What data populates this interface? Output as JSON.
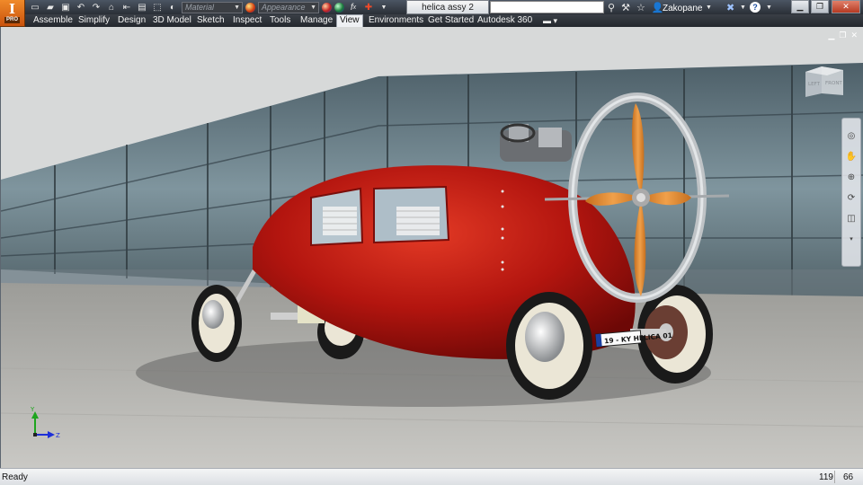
{
  "app": {
    "logo": "I",
    "edition": "PRO"
  },
  "quick_access": {
    "material_placeholder": "Material",
    "appearance_placeholder": "Appearance"
  },
  "document": {
    "title": "helica assy 2"
  },
  "user": {
    "name": "Zakopane"
  },
  "ribbon": {
    "tabs": [
      {
        "label": "Assemble",
        "active": false
      },
      {
        "label": "Simplify",
        "active": false
      },
      {
        "label": "Design",
        "active": false
      },
      {
        "label": "3D Model",
        "active": false
      },
      {
        "label": "Sketch",
        "active": false
      },
      {
        "label": "Inspect",
        "active": false
      },
      {
        "label": "Tools",
        "active": false
      },
      {
        "label": "Manage",
        "active": false
      },
      {
        "label": "View",
        "active": true
      },
      {
        "label": "Environments",
        "active": false
      },
      {
        "label": "Get Started",
        "active": false
      },
      {
        "label": "Autodesk 360",
        "active": false
      }
    ]
  },
  "viewcube": {
    "left_face": "LEFT",
    "front_face": "FRONT"
  },
  "triad": {
    "y_label": "Y",
    "z_label": "Z"
  },
  "vehicle": {
    "plate": "19 - KY HELICA 01"
  },
  "status": {
    "text": "Ready",
    "value1": "119",
    "value2": "66"
  },
  "colors": {
    "accent": "#e8771e",
    "body_red": "#b5150f",
    "propeller": "#e8953a"
  }
}
